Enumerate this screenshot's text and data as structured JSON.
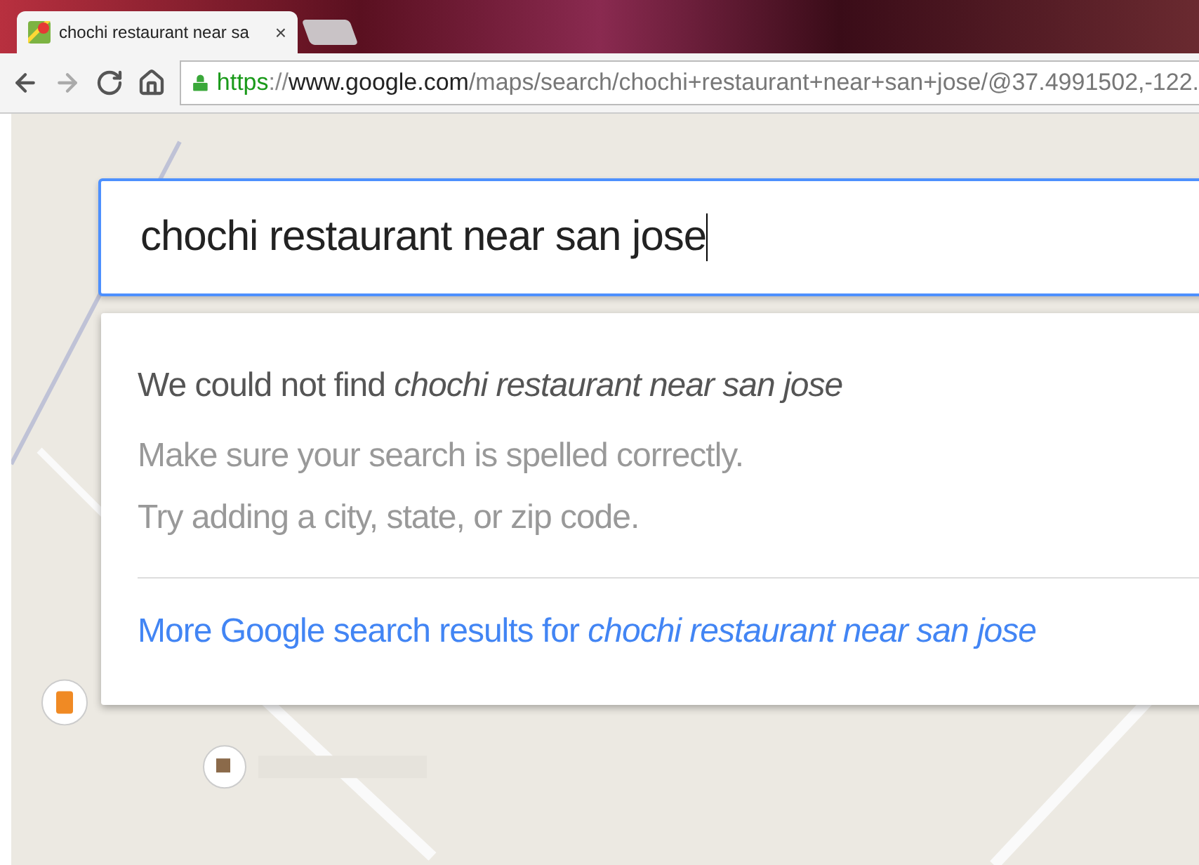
{
  "browser": {
    "tab": {
      "title": "chochi restaurant near sa",
      "close": "×"
    },
    "address": {
      "parts": [
        {
          "text": "https",
          "kind": "scheme"
        },
        {
          "text": "://",
          "kind": "separator"
        },
        {
          "text": "www.google.com",
          "kind": "host"
        },
        {
          "text": "/maps/search/chochi+restaurant+near+san+jose/@37.4991502,-122.",
          "kind": "path"
        }
      ]
    }
  },
  "search": {
    "value": "chochi restaurant near san jose"
  },
  "results_card": {
    "heading": "We could not find *chochi restaurant near san jose*",
    "hints": [
      "Make sure your search is spelled correctly.",
      "Try adding a city, state, or zip code."
    ],
    "link": "More Google search results for *chochi restaurant near san jose*"
  }
}
